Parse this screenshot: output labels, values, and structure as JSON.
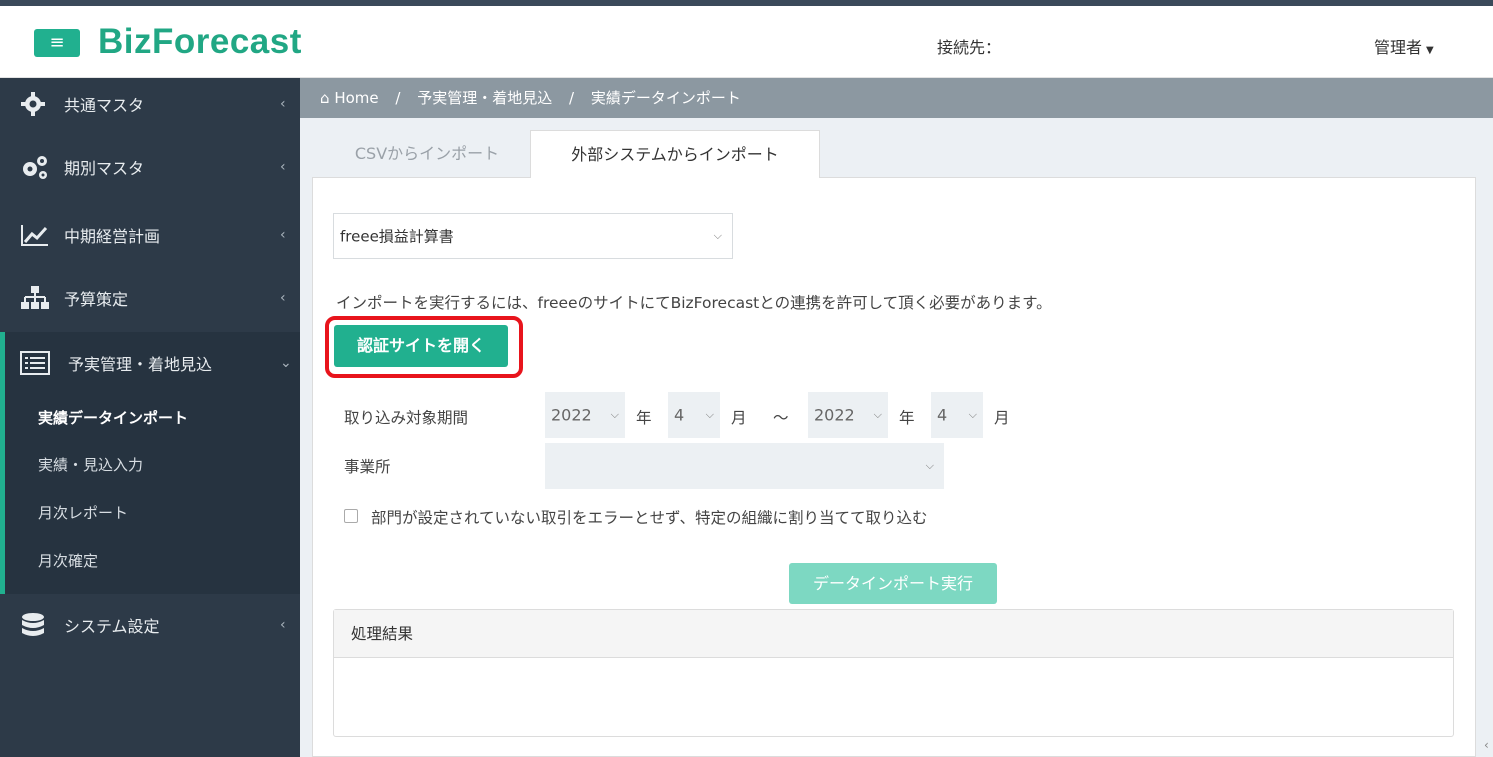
{
  "app": {
    "logo": "BizForecast",
    "menu_icon": "hamburger-icon",
    "brand_color": "#21a784"
  },
  "header": {
    "connection_label": "接続先：",
    "user": "管理者"
  },
  "sidebar": {
    "items": [
      {
        "label": "共通マスタ",
        "icon": "gear-icon"
      },
      {
        "label": "期別マスタ",
        "icon": "gears-icon"
      },
      {
        "label": "中期経営計画",
        "icon": "line-chart-icon"
      },
      {
        "label": "予算策定",
        "icon": "sitemap-icon"
      },
      {
        "label": "予実管理・着地見込",
        "icon": "list-icon"
      },
      {
        "label": "システム設定",
        "icon": "database-icon"
      }
    ],
    "subitems": [
      {
        "label": "実績データインポート",
        "active": true
      },
      {
        "label": "実績・見込入力"
      },
      {
        "label": "月次レポート"
      },
      {
        "label": "月次確定"
      }
    ]
  },
  "breadcrumb": {
    "home": "Home",
    "section": "予実管理・着地見込",
    "page": "実績データインポート"
  },
  "tabs": [
    {
      "label": "CSVからインポート",
      "active": false
    },
    {
      "label": "外部システムからインポート",
      "active": true
    }
  ],
  "form": {
    "source_select": "freee損益計算書",
    "info": "インポートを実行するには、freeeのサイトにてBizForecastとの連携を許可して頂く必要があります。",
    "auth_button": "認証サイトを開く",
    "period_label": "取り込み対象期間",
    "from_year": "2022",
    "from_month": "4",
    "to_year": "2022",
    "to_month": "4",
    "year_unit": "年",
    "month_unit": "月",
    "range_sep": "～",
    "office_label": "事業所",
    "office_value": "",
    "checkbox_label": "部門が設定されていない取引をエラーとせず、特定の組織に割り当てて取り込む",
    "execute_button": "データインポート実行"
  },
  "result": {
    "title": "処理結果"
  }
}
